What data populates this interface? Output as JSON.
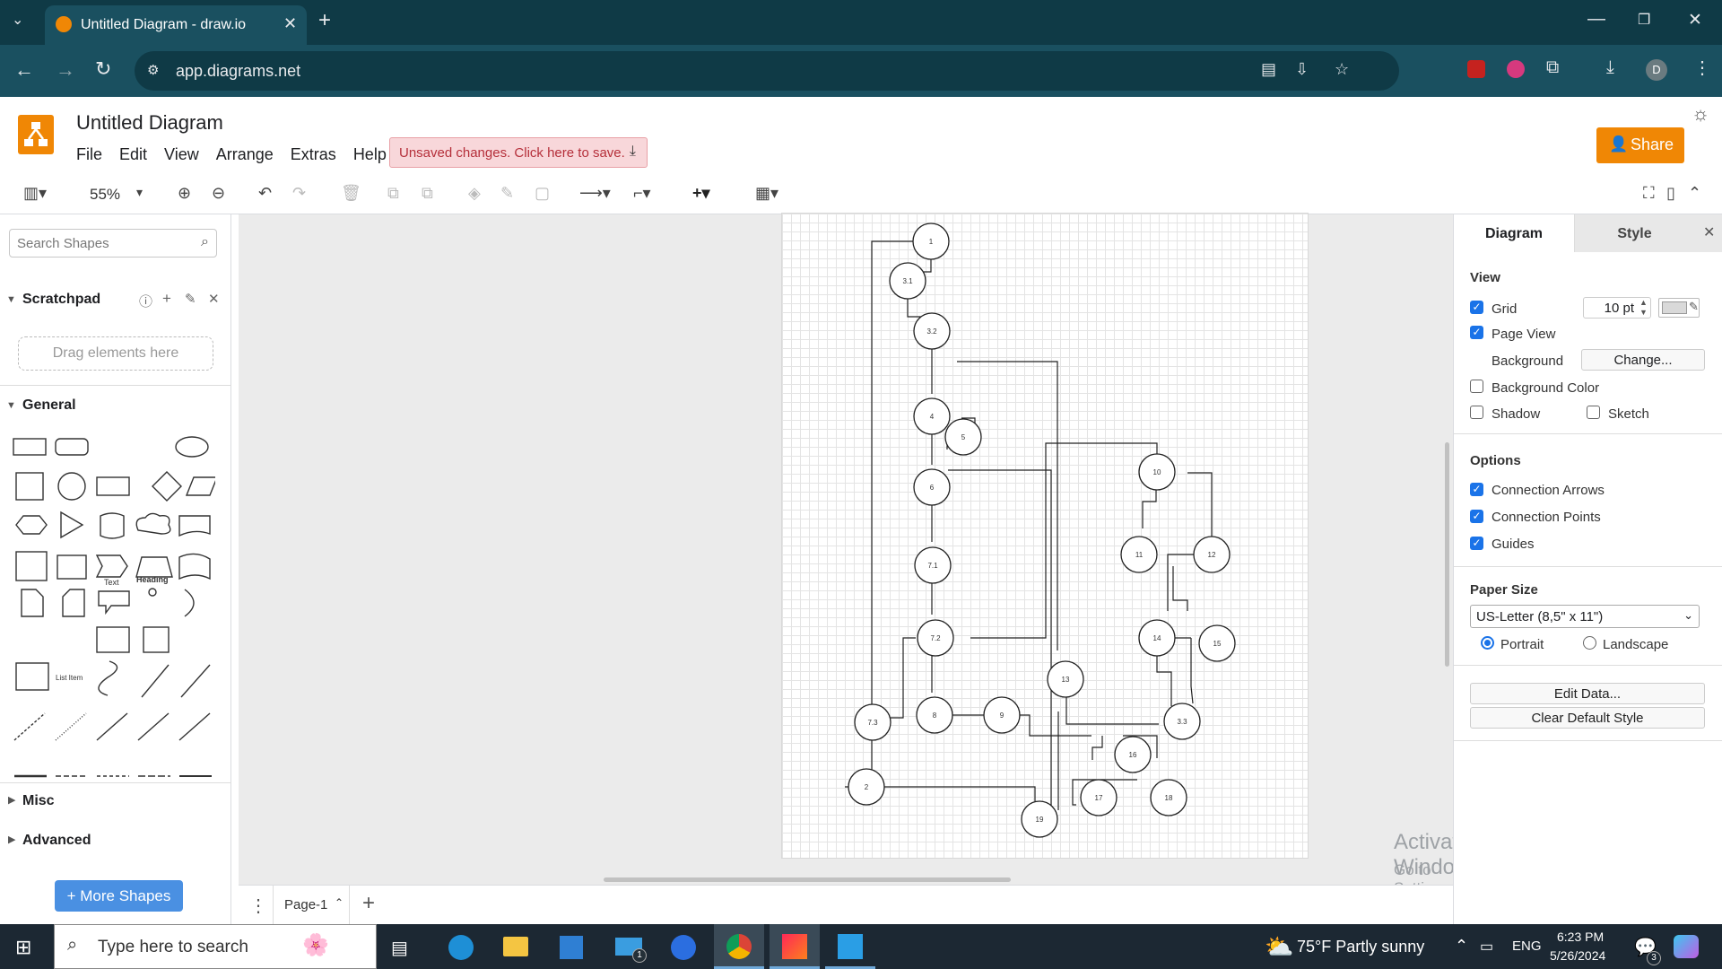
{
  "browser": {
    "tab_title": "Untitled Diagram - draw.io",
    "url": "app.diagrams.net",
    "profile_letter": "D"
  },
  "app": {
    "doc_title": "Untitled Diagram",
    "menus": [
      "File",
      "Edit",
      "View",
      "Arrange",
      "Extras",
      "Help"
    ],
    "unsaved_label": "Unsaved changes. Click here to save.",
    "share_label": "Share",
    "zoom": "55%"
  },
  "left_panel": {
    "search_placeholder": "Search Shapes",
    "scratchpad": "Scratchpad",
    "drag_hint": "Drag elements here",
    "general": "General",
    "shape_text": "Text",
    "shape_heading": "Heading",
    "shape_list_item": "List Item",
    "misc": "Misc",
    "advanced": "Advanced",
    "more_shapes": "+ More Shapes"
  },
  "diagram": {
    "nodes": [
      "1",
      "3.1",
      "3.2",
      "4",
      "5",
      "6",
      "7.1",
      "7.2",
      "7.3",
      "8",
      "9",
      "2",
      "19",
      "10",
      "11",
      "12",
      "14",
      "15",
      "3.3",
      "13",
      "16",
      "17",
      "18"
    ]
  },
  "bottom": {
    "page_tab": "Page-1"
  },
  "right_panel": {
    "tab_diagram": "Diagram",
    "tab_style": "Style",
    "view_header": "View",
    "grid": "Grid",
    "grid_size": "10 pt",
    "page_view": "Page View",
    "background": "Background",
    "change_btn": "Change...",
    "background_color": "Background Color",
    "shadow": "Shadow",
    "sketch": "Sketch",
    "options_header": "Options",
    "connection_arrows": "Connection Arrows",
    "connection_points": "Connection Points",
    "guides": "Guides",
    "paper_size_header": "Paper Size",
    "paper_size": "US-Letter (8,5\" x 11\")",
    "portrait": "Portrait",
    "landscape": "Landscape",
    "edit_data": "Edit Data...",
    "clear_default_style": "Clear Default Style"
  },
  "watermark": {
    "line1": "Activate Windows",
    "line2": "Go to Settings to activate Windows."
  },
  "taskbar": {
    "search_placeholder": "Type here to search",
    "weather": "75°F  Partly sunny",
    "lang": "ENG",
    "time": "6:23 PM",
    "date": "5/26/2024",
    "mail_badge": "1",
    "notif_badge": "3"
  }
}
